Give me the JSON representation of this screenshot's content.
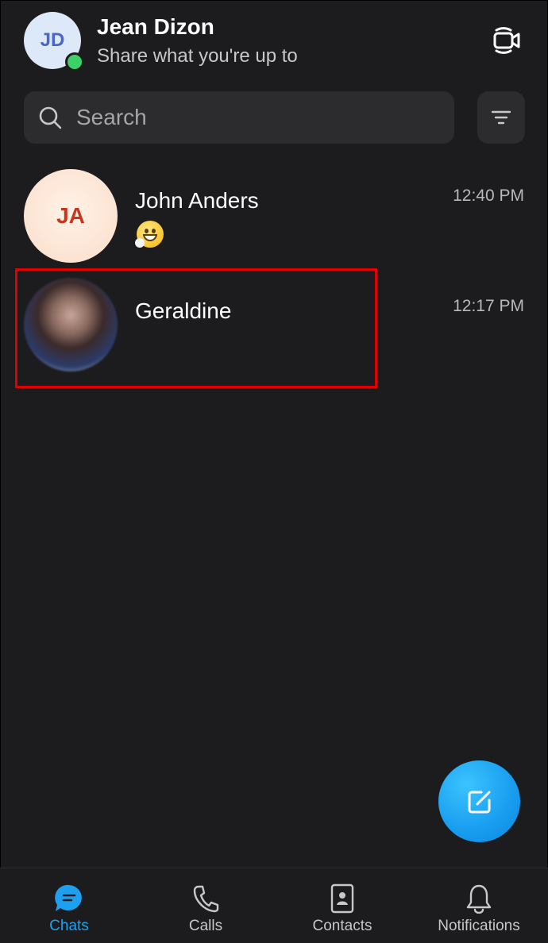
{
  "header": {
    "avatar_initials": "JD",
    "user_name": "Jean Dizon",
    "status_message": "Share what you're up to",
    "presence": "online",
    "meet_icon": "video-camera-icon"
  },
  "search": {
    "placeholder": "Search",
    "filter_icon": "filter-icon"
  },
  "chats": [
    {
      "name": "John Anders",
      "initials": "JA",
      "time": "12:40 PM",
      "preview": "emoji-grin"
    },
    {
      "name": "Geraldine",
      "time": "12:17 PM",
      "avatar": "photo"
    }
  ],
  "compose_icon": "compose-icon",
  "tabs": [
    {
      "label": "Chats",
      "icon": "chat-bubble-icon",
      "active": true
    },
    {
      "label": "Calls",
      "icon": "phone-icon",
      "active": false
    },
    {
      "label": "Contacts",
      "icon": "contacts-book-icon",
      "active": false
    },
    {
      "label": "Notifications",
      "icon": "bell-icon",
      "active": false
    }
  ],
  "colors": {
    "background": "#1c1c1e",
    "accent": "#1ea0f0",
    "highlight_box": "#e00000",
    "presence_green": "#3dd16a"
  }
}
